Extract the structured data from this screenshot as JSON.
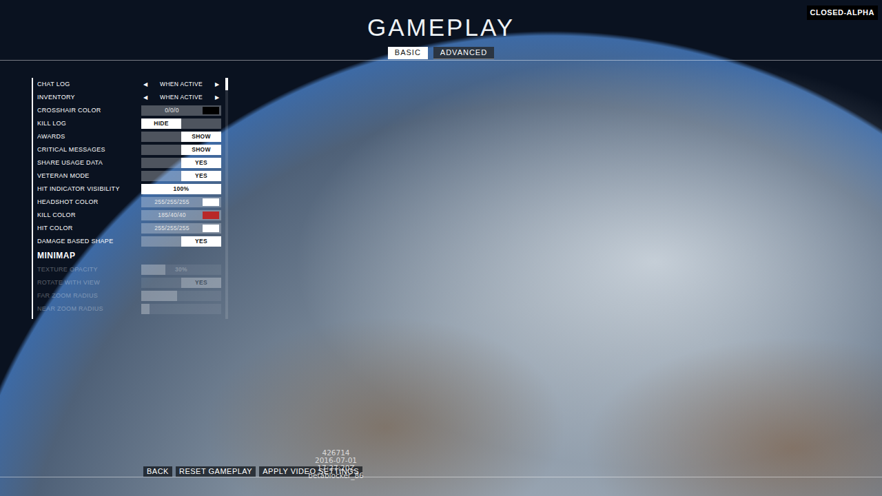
{
  "title": "GAMEPLAY",
  "badge": "CLOSED-ALPHA",
  "tabs": [
    {
      "label": "BASIC",
      "selected": true
    },
    {
      "label": "ADVANCED",
      "selected": false
    }
  ],
  "settings": [
    {
      "kind": "selector",
      "label": "CHAT LOG",
      "value": "WHEN ACTIVE",
      "prev": "◀",
      "next": "▶",
      "dimmed": false
    },
    {
      "kind": "selector",
      "label": "INVENTORY",
      "value": "WHEN ACTIVE",
      "prev": "◀",
      "next": "▶",
      "dimmed": false
    },
    {
      "kind": "color",
      "label": "CROSSHAIR COLOR",
      "value": "0/0/0",
      "color": "#000000",
      "dimmed": false
    },
    {
      "kind": "toggle",
      "label": "KILL LOG",
      "value": "HIDE",
      "on": false,
      "dimmed": false
    },
    {
      "kind": "toggle",
      "label": "AWARDS",
      "value": "SHOW",
      "on": true,
      "dimmed": false
    },
    {
      "kind": "toggle",
      "label": "CRITICAL MESSAGES",
      "value": "SHOW",
      "on": true,
      "dimmed": false
    },
    {
      "kind": "toggle",
      "label": "SHARE USAGE DATA",
      "value": "YES",
      "on": true,
      "dimmed": false
    },
    {
      "kind": "toggle",
      "label": "VETERAN MODE",
      "value": "YES",
      "on": true,
      "dimmed": false
    },
    {
      "kind": "slider",
      "label": "HIT INDICATOR VISIBILITY",
      "value": "100%",
      "level": 1,
      "dimmed": false
    },
    {
      "kind": "color",
      "label": "HEADSHOT COLOR",
      "value": "255/255/255",
      "color": "#ffffff",
      "dimmed": false
    },
    {
      "kind": "color",
      "label": "KILL COLOR",
      "value": "185/40/40",
      "color": "#b92828",
      "dimmed": false
    },
    {
      "kind": "color",
      "label": "HIT COLOR",
      "value": "255/255/255",
      "color": "#ffffff",
      "dimmed": false
    },
    {
      "kind": "toggle",
      "label": "DAMAGE BASED SHAPE",
      "value": "YES",
      "on": true,
      "dimmed": false
    },
    {
      "kind": "header",
      "label": "MINIMAP"
    },
    {
      "kind": "slider",
      "label": "TEXTURE OPACITY",
      "value": "30%",
      "level": 0.3,
      "dimmed": true
    },
    {
      "kind": "toggle",
      "label": "ROTATE WITH VIEW",
      "value": "YES",
      "on": true,
      "dimmed": true
    },
    {
      "kind": "slider",
      "label": "FAR ZOOM RADIUS",
      "level": 0.45,
      "dimmed": true
    },
    {
      "kind": "slider",
      "label": "NEAR ZOOM RADIUS",
      "level": 0.1,
      "dimmed": true
    }
  ],
  "buttons": [
    "BACK",
    "RESET GAMEPLAY",
    "APPLY VIDEO SETTINGS"
  ],
  "watermark": [
    "426714",
    "2016-07-01",
    "17:27:20Z",
    "betablocker_86"
  ]
}
